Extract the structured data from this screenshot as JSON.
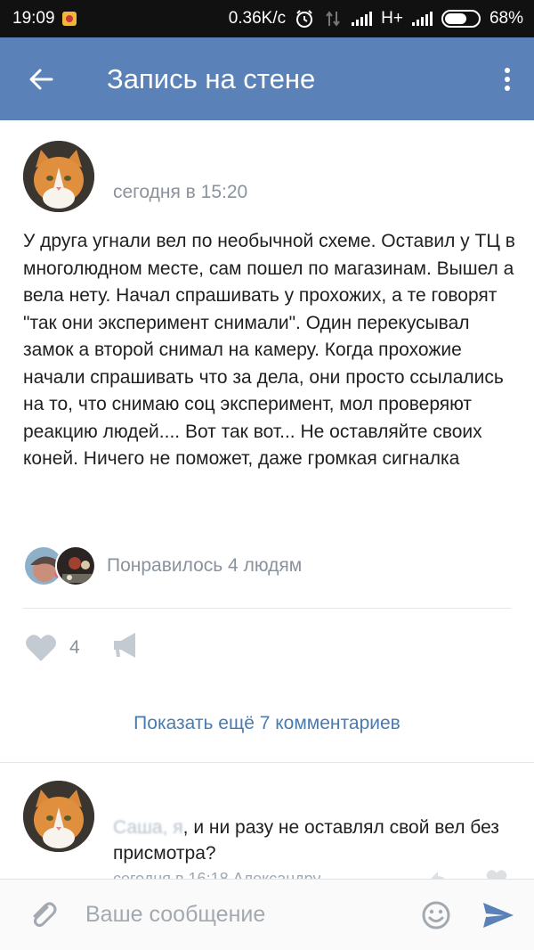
{
  "status_bar": {
    "time": "19:09",
    "net_speed": "0.36K/c",
    "network_type": "H+",
    "battery": "68%",
    "battery_level": 0.68,
    "icons": [
      "notification-icon",
      "alarm-icon",
      "data-transfer-icon",
      "signal-icon",
      "battery-icon"
    ]
  },
  "app_bar": {
    "title": "Запись на стене",
    "back_icon": "arrow-left-icon",
    "menu_icon": "more-vertical-icon",
    "background_color": "#5b82b8"
  },
  "post": {
    "date": "сегодня в 15:20",
    "text": "У друга угнали вел по необычной схеме. Оставил у ТЦ в многолюдном месте, сам пошел по магазинам. Вышел а вела нету. Начал спрашивать у прохожих, а те говорят \"так они эксперимент снимали\". Один перекусывал замок а второй снимал на камеру. Когда прохожие начали спрашивать что за дела, они просто ссылались на то, что снимаю соц эксперимент, мол проверяют реакцию людей.... Вот так вот... Не оставляйте своих коней. Ничего не поможет, даже громкая сигналка",
    "likes_text": "Понравилось 4 людям",
    "like_count": "4",
    "like_icon": "heart-icon",
    "share_icon": "megaphone-icon"
  },
  "comments": {
    "show_more": "Показать ещё 7 комментариев",
    "items": [
      {
        "text_hidden": "Саша, я",
        "text": ", и ни разу не оставлял свой вел без присмотра?",
        "meta": "сегодня в 16:18 Александру"
      }
    ]
  },
  "composer": {
    "placeholder": "Ваше сообщение",
    "attach_icon": "paperclip-icon",
    "emoji_icon": "smiley-icon",
    "send_icon": "send-icon",
    "accent_color": "#5b82b8"
  }
}
